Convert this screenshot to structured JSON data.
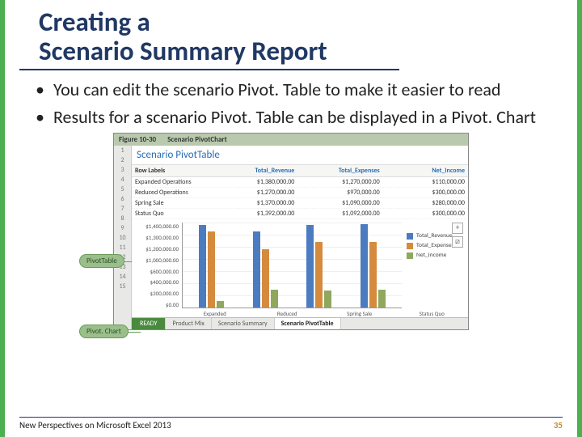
{
  "title_line1": "Creating a",
  "title_line2": "Scenario Summary Report",
  "bullets": [
    "You can edit the scenario Pivot. Table to make it easier to read",
    "Results for a scenario Pivot. Table can be displayed in a Pivot. Chart"
  ],
  "figure": {
    "label": "Figure 10-30",
    "caption": "Scenario PivotChart",
    "pivot_title": "Scenario PivotTable",
    "row_label_header": "Row Labels",
    "callout_table": "PivotTable",
    "callout_chart": "Pivot. Chart",
    "tabs": [
      "Product Mix",
      "Scenario Summary",
      "Scenario PivotTable"
    ],
    "ready": "READY",
    "side_plus": "+",
    "side_filter": "⧄"
  },
  "chart_data": {
    "type": "bar",
    "categories": [
      "Expanded Operations",
      "Reduced Operations",
      "Spring Sale",
      "Status Quo"
    ],
    "series": [
      {
        "name": "Total_Revenue",
        "values": [
          1380000,
          1270000,
          1370000,
          1392000
        ]
      },
      {
        "name": "Total_Expenses",
        "values": [
          1270000,
          970000,
          1090000,
          1092000
        ]
      },
      {
        "name": "Net_Income",
        "values": [
          110000,
          300000,
          280000,
          300000
        ]
      }
    ],
    "yticks": [
      "$1,400,000.00",
      "$1,300,000.00",
      "$1,200,000.00",
      "$1,000,000.00",
      "$600,000.00",
      "$400,000.00",
      "$200,000.00",
      "$0.00"
    ],
    "ylim": [
      0,
      1400000
    ],
    "xlabels": [
      "Expanded",
      "Reduced",
      "Spring Sale",
      "Status Quo"
    ],
    "row_values_text": [
      [
        "$1,380,000.00",
        "$1,270,000.00",
        "$110,000.00"
      ],
      [
        "$1,270,000.00",
        "$970,000.00",
        "$300,000.00"
      ],
      [
        "$1,370,000.00",
        "$1,090,000.00",
        "$280,000.00"
      ],
      [
        "$1,392,000.00",
        "$1,092,000.00",
        "$300,000.00"
      ]
    ]
  },
  "footer": {
    "text": "New Perspectives on Microsoft Excel 2013",
    "page": "35"
  }
}
